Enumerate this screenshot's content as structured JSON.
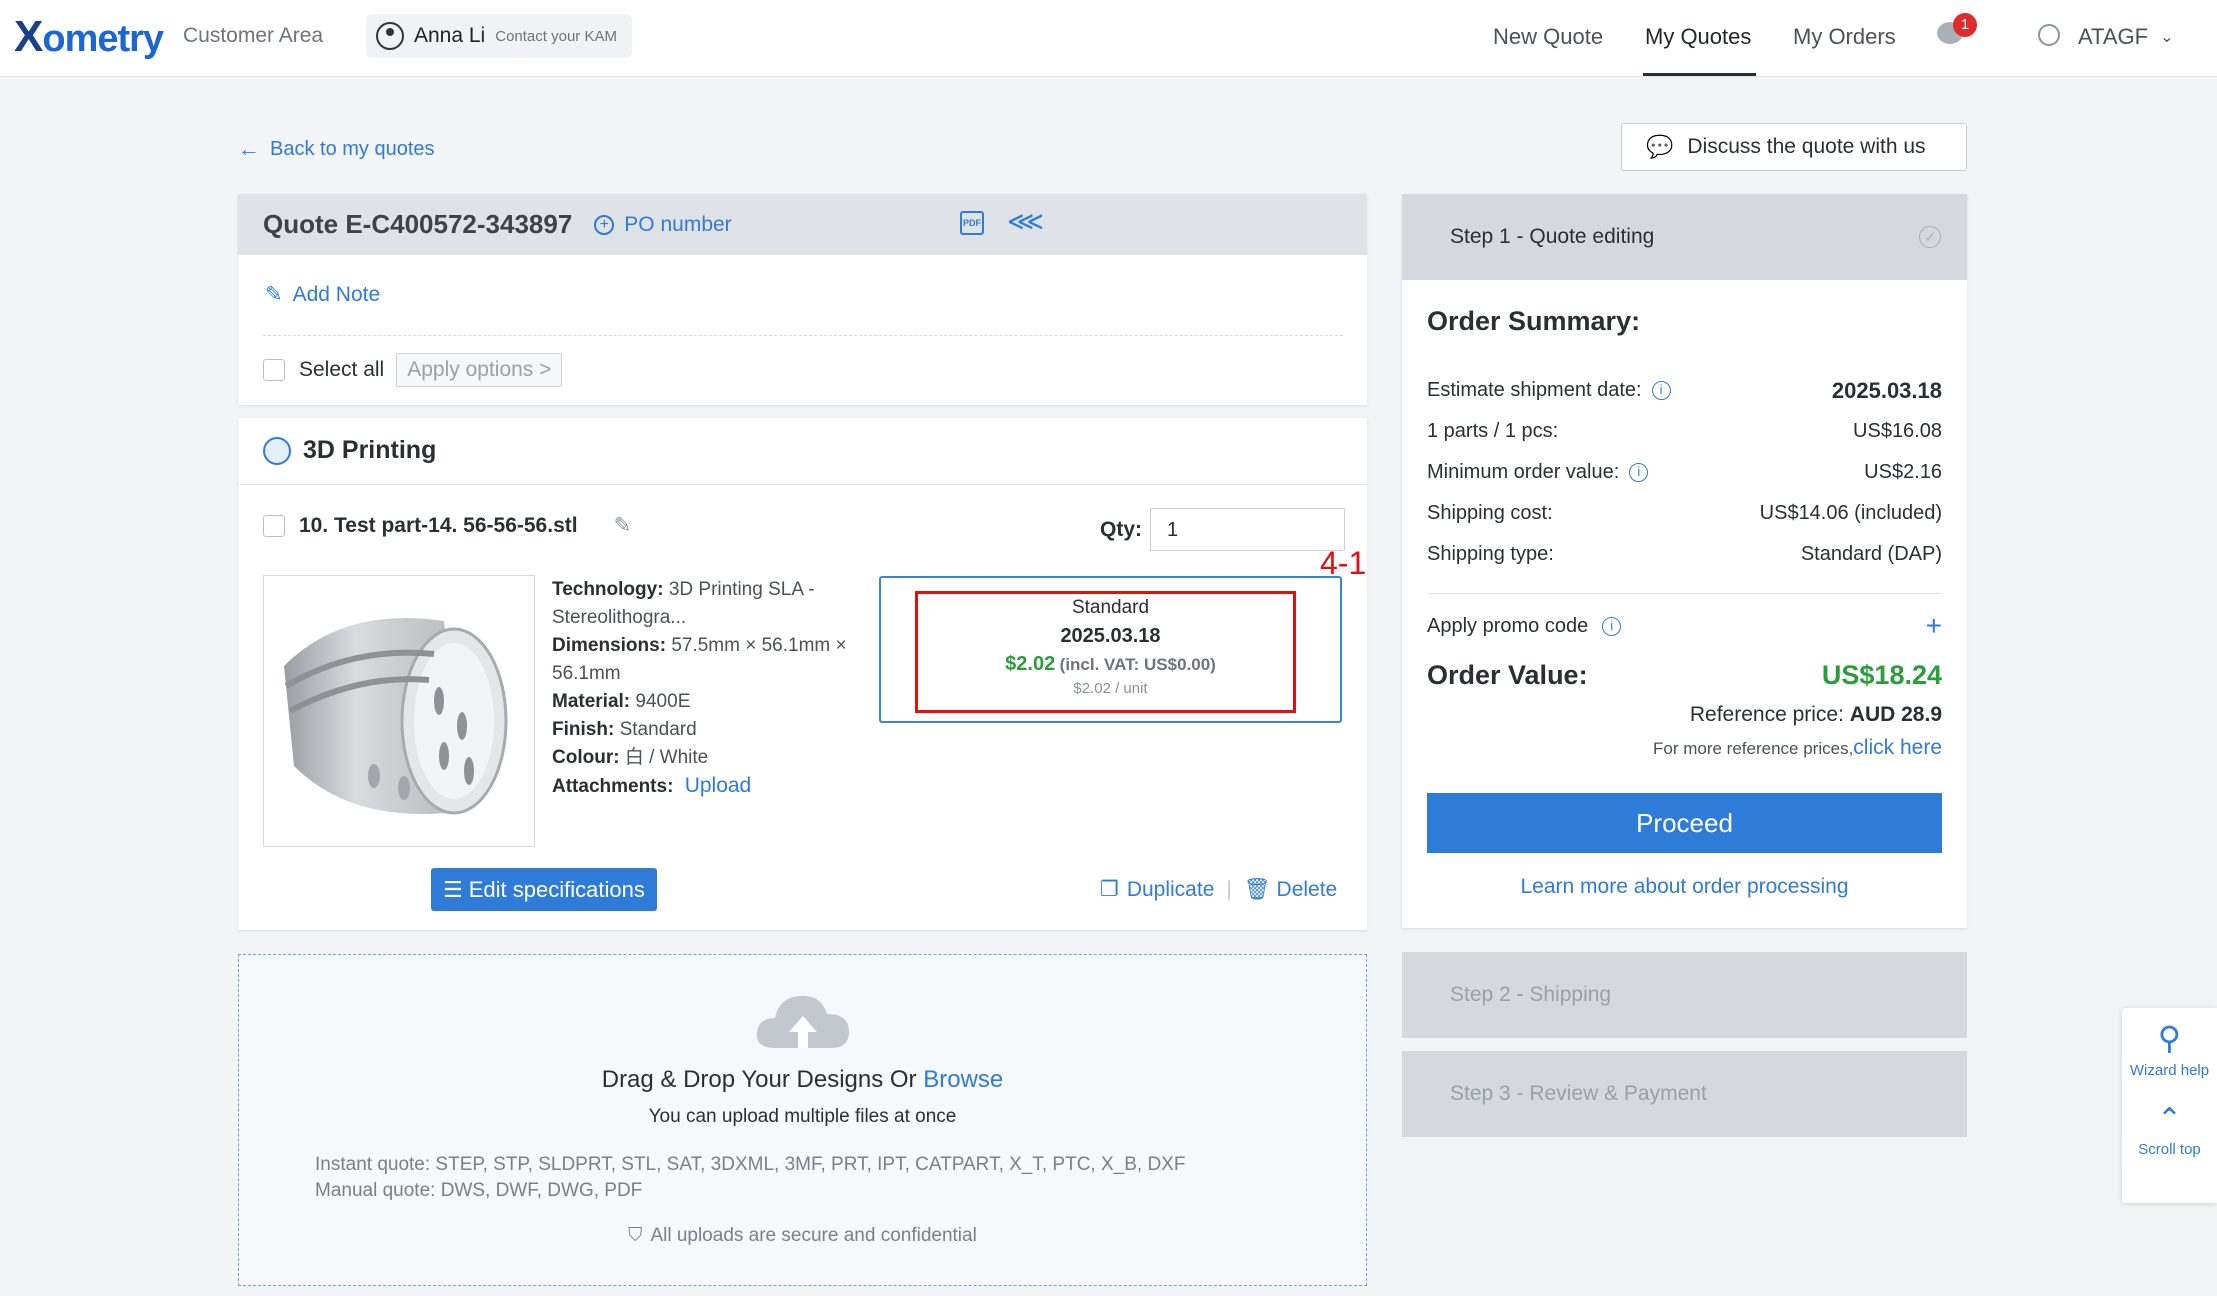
{
  "header": {
    "logo": "xometry",
    "customer_area": "Customer Area",
    "user_name": "Anna Li",
    "kam": "Contact your KAM",
    "nav": [
      "New Quote",
      "My Quotes",
      "My Orders"
    ],
    "notification_count": "1",
    "language": "ATAGF"
  },
  "back_link": "Back to my quotes",
  "discuss_label": "Discuss the quote with us",
  "quote": {
    "title": "Quote E-C400572-343897",
    "po_label": "PO number",
    "add_note": "Add Note",
    "select_all": "Select all",
    "apply_options": "Apply options >"
  },
  "section": {
    "title": "3D Printing",
    "part_name": "10. Test part-14. 56-56-56.stl",
    "qty_label": "Qty:",
    "qty_value": "1",
    "annotation": "4-1",
    "specs": {
      "technology_label": "Technology:",
      "technology_value": "3D Printing SLA - Stereolithogra...",
      "dimensions_label": "Dimensions:",
      "dimensions_value": "57.5mm × 56.1mm × 56.1mm",
      "material_label": "Material:",
      "material_value": "9400E",
      "finish_label": "Finish:",
      "finish_value": "Standard",
      "colour_label": "Colour:",
      "colour_value": "⽩ / White",
      "attachments_label": "Attachments:",
      "upload_label": "Upload"
    },
    "price": {
      "type": "Standard",
      "date": "2025.03.18",
      "price": "$2.02",
      "vat": "(incl. VAT: US$0.00)",
      "unit": "$2.02 / unit"
    },
    "edit_spec": "Edit specifications",
    "duplicate": "Duplicate",
    "delete": "Delete"
  },
  "upload": {
    "title": "Drag & Drop Your Designs Or",
    "browse": "Browse",
    "sub": "You can upload multiple files at once",
    "instant": "Instant quote: STEP, STP, SLDPRT, STL, SAT, 3DXML, 3MF, PRT, IPT, CATPART, X_T, PTC, X_B, DXF",
    "manual": "Manual quote: DWS, DWF, DWG, PDF",
    "secure": "All uploads are secure and confidential"
  },
  "summary": {
    "step1": "Step 1 - Quote editing",
    "title": "Order Summary:",
    "rows": [
      {
        "label": "Estimate shipment date:",
        "value": "2025.03.18"
      },
      {
        "label": "1 parts / 1 pcs:",
        "value": "US$16.08"
      },
      {
        "label": "Minimum order value:",
        "value": "US$2.16"
      },
      {
        "label": "Shipping cost:",
        "value": "US$14.06 (included)"
      },
      {
        "label": "Shipping type:",
        "value": "Standard (DAP)"
      }
    ],
    "promo": "Apply promo code",
    "order_value_label": "Order Value:",
    "order_value": "US$18.24",
    "reference_label": "Reference price:",
    "reference_value": "AUD 28.9",
    "more_ref": "For more reference prices,",
    "click_here": "click here",
    "proceed": "Proceed",
    "learn_more": "Learn more about order processing",
    "step2": "Step 2 - Shipping",
    "step3": "Step 3 - Review & Payment"
  },
  "side_help": {
    "wizard": "Wizard help",
    "scroll": "Scroll top"
  }
}
